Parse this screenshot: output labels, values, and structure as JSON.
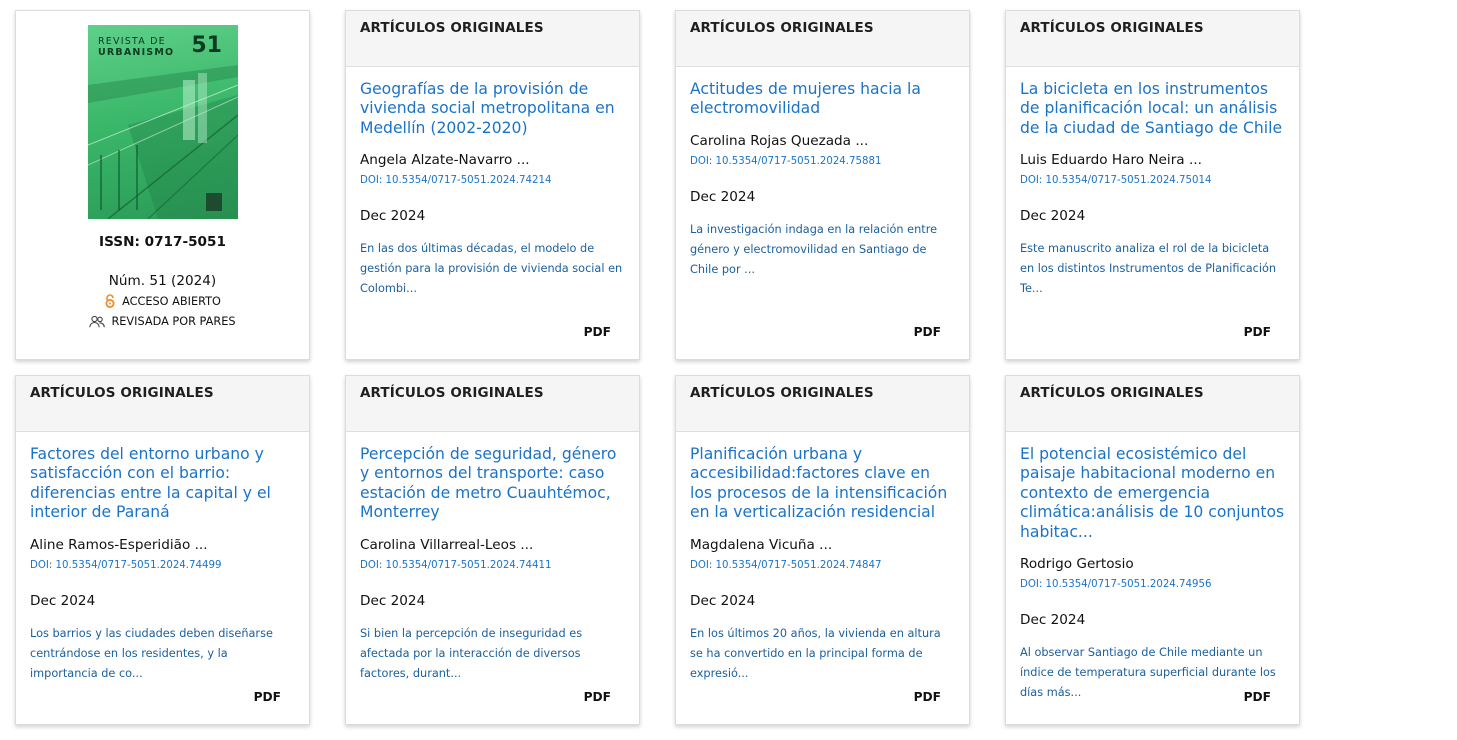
{
  "journal": {
    "cover_title_line1": "REVISTA DE",
    "cover_title_line2": "URBANISMO",
    "cover_number": "51",
    "issn": "ISSN: 0717-5051",
    "issue": "Núm. 51 (2024)",
    "open_access": "ACCESO ABIERTO",
    "peer_reviewed": "REVISADA POR PARES",
    "accent_color": "#3bb86a"
  },
  "articles": [
    {
      "section": "ARTÍCULOS ORIGINALES",
      "title": "Geografías de la provisión de vivienda social metropolitana en Medellín (2002-2020)",
      "authors": "Angela Alzate-Navarro ...",
      "doi": "DOI: 10.5354/0717-5051.2024.74214",
      "date": "Dec 2024",
      "abstract": "En las dos últimas décadas, el modelo de gestión para la provisión de vivienda social en Colombi...",
      "pdf": "PDF"
    },
    {
      "section": "ARTÍCULOS ORIGINALES",
      "title": "Actitudes de mujeres hacia la electromovilidad",
      "authors": "Carolina Rojas Quezada ...",
      "doi": "DOI: 10.5354/0717-5051.2024.75881",
      "date": "Dec 2024",
      "abstract": "La investigación indaga en la relación entre género y electromovilidad en Santiago de Chile por ...",
      "pdf": "PDF"
    },
    {
      "section": "ARTÍCULOS ORIGINALES",
      "title": "La bicicleta en los instrumentos de planificación local: un análisis de la ciudad de Santiago de Chile",
      "authors": "Luis Eduardo Haro Neira ...",
      "doi": "DOI: 10.5354/0717-5051.2024.75014",
      "date": "Dec 2024",
      "abstract": "Este manuscrito analiza el rol de la bicicleta en los distintos Instrumentos de Planificación Te...",
      "pdf": "PDF"
    },
    {
      "section": "ARTÍCULOS ORIGINALES",
      "title": "Factores del entorno urbano y satisfacción con el barrio: diferencias entre la capital y el interior de Paraná",
      "authors": "Aline Ramos-Esperidião ...",
      "doi": "DOI: 10.5354/0717-5051.2024.74499",
      "date": "Dec 2024",
      "abstract": "Los barrios y las ciudades deben diseñarse centrándose en los residentes, y la importancia de co...",
      "pdf": "PDF"
    },
    {
      "section": "ARTÍCULOS ORIGINALES",
      "title": "Percepción de seguridad, género y entornos del transporte: caso estación de metro Cuauhtémoc, Monterrey",
      "authors": "Carolina Villarreal-Leos ...",
      "doi": "DOI: 10.5354/0717-5051.2024.74411",
      "date": "Dec 2024",
      "abstract": "Si bien la percepción de inseguridad es afectada por la interacción de diversos factores, durant...",
      "pdf": "PDF"
    },
    {
      "section": "ARTÍCULOS ORIGINALES",
      "title": "Planificación urbana y accesibilidad:factores clave en los procesos de la intensificación en la verticalización residencial",
      "authors": "Magdalena Vicuña ...",
      "doi": "DOI: 10.5354/0717-5051.2024.74847",
      "date": "Dec 2024",
      "abstract": "En los últimos 20 años, la vivienda en altura se ha convertido en la principal forma de expresió...",
      "pdf": "PDF"
    },
    {
      "section": "ARTÍCULOS ORIGINALES",
      "title": "El potencial ecosistémico del paisaje habitacional moderno en contexto de emergencia climática:análisis de 10 conjuntos habitac...",
      "authors": "Rodrigo Gertosio",
      "doi": "DOI: 10.5354/0717-5051.2024.74956",
      "date": "Dec 2024",
      "abstract": "Al observar Santiago de Chile mediante un índice de temperatura superficial durante los días más...",
      "pdf": "PDF"
    }
  ]
}
